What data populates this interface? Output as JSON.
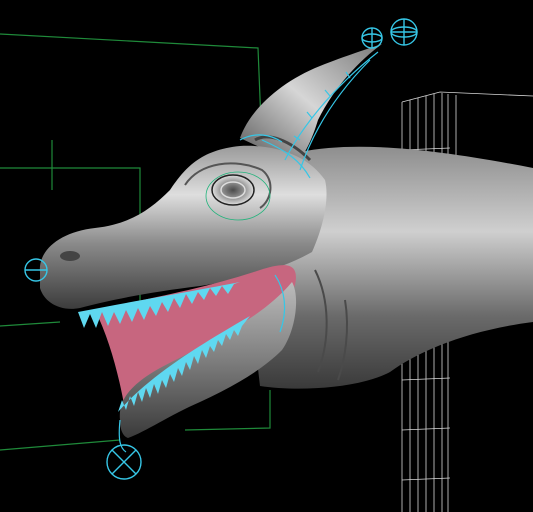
{
  "viewport": {
    "background": "#000000",
    "grid_color": "#1f8a3a",
    "wireframe_color": "#d8d8d8",
    "rig_color": "#36c6e6",
    "teeth_color": "#5fd8f0",
    "mouth_color": "#c7667f",
    "skin_dark": "#2a2a2a",
    "skin_mid": "#7a7a7a",
    "skin_light": "#d9d9d9"
  },
  "scene": {
    "subject": "3d-creature-head-model",
    "rig_controls": [
      "horn-tip-locator",
      "horn-tip-locator-secondary",
      "snout-locator",
      "jaw-locator"
    ]
  }
}
